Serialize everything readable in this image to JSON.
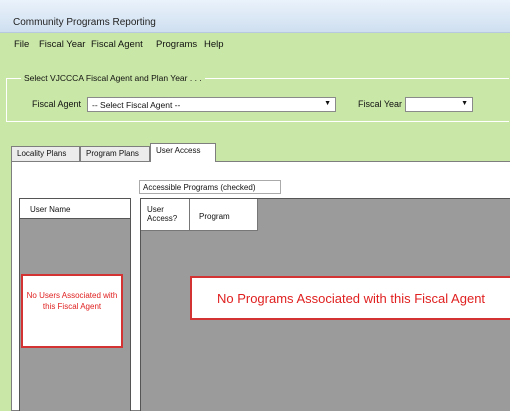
{
  "window": {
    "title": "Community Programs Reporting"
  },
  "menu": [
    "File",
    "Fiscal Year",
    "Fiscal Agent",
    "Programs",
    "Help"
  ],
  "selection": {
    "legend": "Select VJCCCA Fiscal Agent and Plan Year . . .",
    "fiscal_agent_label": "Fiscal Agent",
    "fiscal_agent_value": "-- Select Fiscal Agent --",
    "fiscal_year_label": "Fiscal Year",
    "fiscal_year_value": ""
  },
  "tabs": [
    {
      "label": "Locality Plans",
      "active": false
    },
    {
      "label": "Program Plans",
      "active": false
    },
    {
      "label": "User Access",
      "active": true
    }
  ],
  "user_access": {
    "accessible_label": "Accessible Programs (checked)",
    "user_grid": {
      "header": "User Name",
      "empty_message": "No Users Associated with this Fiscal Agent"
    },
    "program_grid": {
      "columns": [
        "User Access?",
        "Program"
      ],
      "empty_message": "No Programs Associated with this Fiscal Agent"
    }
  },
  "icons": {
    "dropdown": "chevron-down-icon"
  },
  "colors": {
    "background": "#c9e7a6",
    "grid": "#9b9b9b",
    "alert": "#e02020"
  }
}
